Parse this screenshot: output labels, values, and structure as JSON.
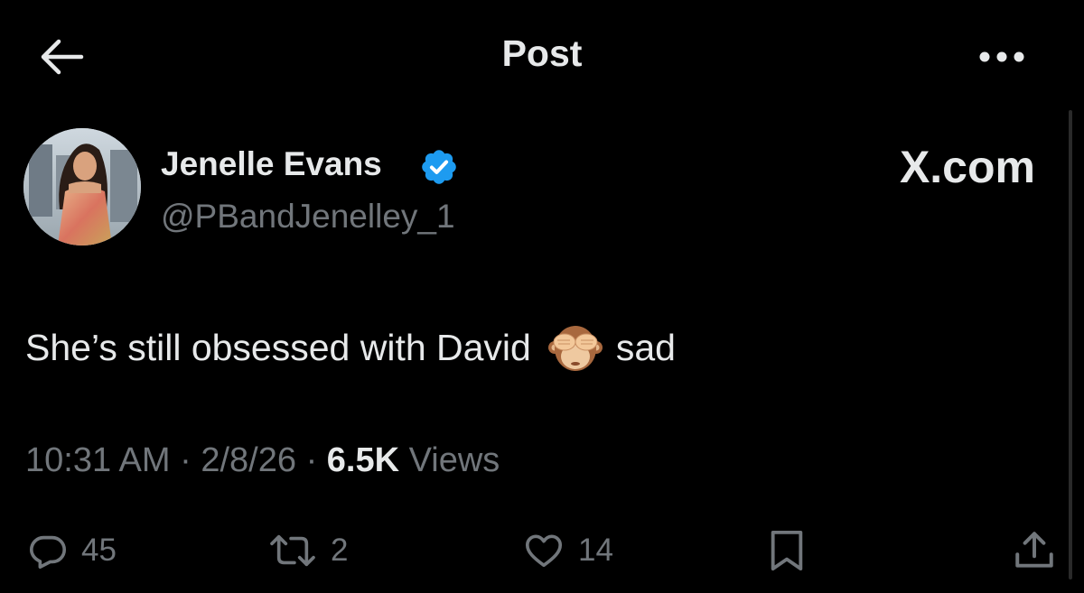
{
  "header": {
    "title": "Post",
    "back_icon": "arrow-left-icon",
    "more_icon": "more-horizontal-icon"
  },
  "author": {
    "name": "Jenelle Evans",
    "handle": "@PBandJenelley_1",
    "verified": true,
    "verified_color": "#1d9bf0"
  },
  "watermark": "X.com",
  "tweet": {
    "text_before": "She’s still obsessed with David",
    "emoji": "see-no-evil-monkey",
    "text_after": "sad"
  },
  "meta": {
    "time": "10:31 AM",
    "separator": "·",
    "date": "2/8/26",
    "views_count": "6.5K",
    "views_label": "Views"
  },
  "actions": {
    "replies": "45",
    "reposts": "2",
    "likes": "14"
  },
  "colors": {
    "background": "#000000",
    "primary_text": "#e7e9ea",
    "secondary_text": "#71767b"
  }
}
